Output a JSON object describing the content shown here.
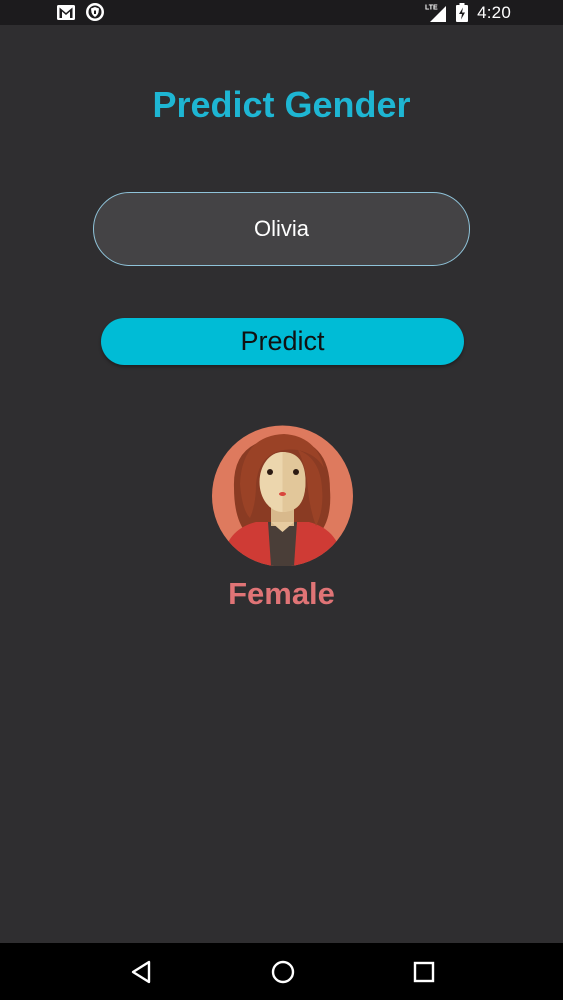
{
  "status_bar": {
    "time": "4:20",
    "left_icons": [
      "gmail-icon",
      "vpn-shield-icon"
    ],
    "right_icons": [
      "lte-signal-icon",
      "battery-charging-icon"
    ],
    "network_label": "LTE"
  },
  "title": "Predict Gender",
  "name_input": {
    "value": "Olivia"
  },
  "predict_button": {
    "label": "Predict"
  },
  "result": {
    "avatar_icon": "female-avatar-icon",
    "label": "Female"
  },
  "nav_bar": {
    "icons": [
      "back-icon",
      "home-icon",
      "recents-icon"
    ]
  },
  "colors": {
    "background": "#2f2e30",
    "accent": "#00bcd6",
    "title": "#1eb6d3",
    "result_female": "#e07476"
  }
}
